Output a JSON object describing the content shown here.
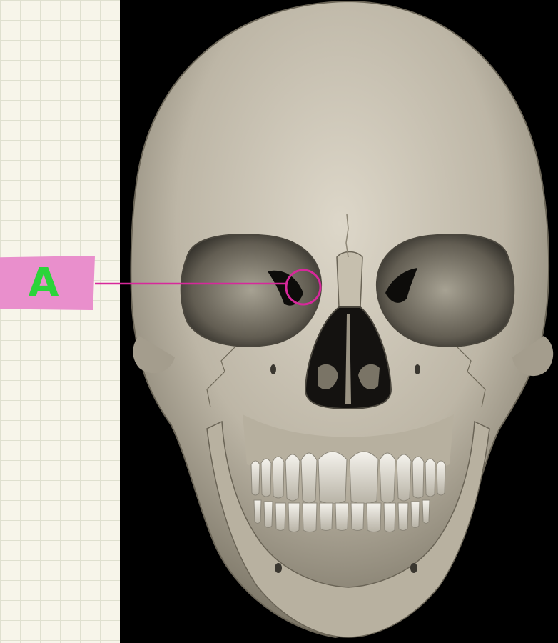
{
  "labels": [
    {
      "id": "A",
      "text": "A"
    }
  ],
  "colors": {
    "grid_background": "#f7f5ea",
    "grid_lines": "#dfe0cf",
    "tag_fill": "#e98fcc",
    "tag_text": "#2bd43a",
    "leader_line": "#d7289b",
    "bone": "#cdc6b6",
    "background": "#000000"
  },
  "image": {
    "subject": "skull-anterior-view",
    "icon": "skull-icon"
  }
}
